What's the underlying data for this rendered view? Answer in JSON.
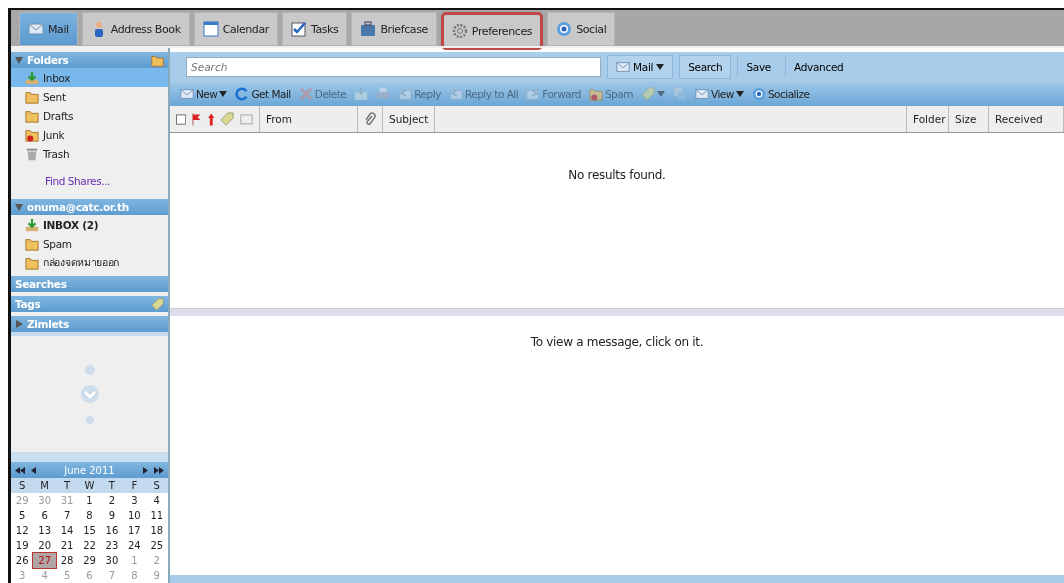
{
  "tabs": [
    {
      "label": "Mail",
      "kind": "envelope",
      "selected": true,
      "highlighted": false
    },
    {
      "label": "Address Book",
      "kind": "person",
      "selected": false,
      "highlighted": false
    },
    {
      "label": "Calendar",
      "kind": "calendar",
      "selected": false,
      "highlighted": false
    },
    {
      "label": "Tasks",
      "kind": "check",
      "selected": false,
      "highlighted": false
    },
    {
      "label": "Briefcase",
      "kind": "briefcase",
      "selected": false,
      "highlighted": false
    },
    {
      "label": "Preferences",
      "kind": "gear",
      "selected": false,
      "highlighted": true
    },
    {
      "label": "Social",
      "kind": "social",
      "selected": false,
      "highlighted": false
    }
  ],
  "sidebar": {
    "folders": {
      "title": "Folders",
      "expanded": true,
      "items": [
        {
          "label": "Inbox",
          "kind": "inbox",
          "selected": true,
          "bold": false
        },
        {
          "label": "Sent",
          "kind": "folder",
          "selected": false,
          "bold": false
        },
        {
          "label": "Drafts",
          "kind": "folder",
          "selected": false,
          "bold": false
        },
        {
          "label": "Junk",
          "kind": "junk",
          "selected": false,
          "bold": false
        },
        {
          "label": "Trash",
          "kind": "trash",
          "selected": false,
          "bold": false
        }
      ],
      "link": "Find Shares..."
    },
    "account": {
      "title": "onuma@catc.or.th",
      "expanded": true,
      "items": [
        {
          "label": "INBOX (2)",
          "kind": "inbox",
          "selected": false,
          "bold": true
        },
        {
          "label": "Spam",
          "kind": "folder",
          "selected": false,
          "bold": false
        },
        {
          "label": "กล่องจดหมายออก",
          "kind": "folder",
          "selected": false,
          "bold": false
        }
      ]
    },
    "searches": {
      "title": "Searches"
    },
    "tags": {
      "title": "Tags"
    },
    "zimlets": {
      "title": "Zimlets",
      "expanded": false
    }
  },
  "calendar": {
    "title": "June 2011",
    "weekdays": [
      "S",
      "M",
      "T",
      "W",
      "T",
      "F",
      "S"
    ],
    "weeks": [
      [
        {
          "label": "29",
          "outside": true,
          "selected": false
        },
        {
          "label": "30",
          "outside": true,
          "selected": false
        },
        {
          "label": "31",
          "outside": true,
          "selected": false
        },
        {
          "label": "1",
          "outside": false,
          "selected": false
        },
        {
          "label": "2",
          "outside": false,
          "selected": false
        },
        {
          "label": "3",
          "outside": false,
          "selected": false
        },
        {
          "label": "4",
          "outside": false,
          "selected": false
        }
      ],
      [
        {
          "label": "5",
          "outside": false,
          "selected": false
        },
        {
          "label": "6",
          "outside": false,
          "selected": false
        },
        {
          "label": "7",
          "outside": false,
          "selected": false
        },
        {
          "label": "8",
          "outside": false,
          "selected": false
        },
        {
          "label": "9",
          "outside": false,
          "selected": false
        },
        {
          "label": "10",
          "outside": false,
          "selected": false
        },
        {
          "label": "11",
          "outside": false,
          "selected": false
        }
      ],
      [
        {
          "label": "12",
          "outside": false,
          "selected": false
        },
        {
          "label": "13",
          "outside": false,
          "selected": false
        },
        {
          "label": "14",
          "outside": false,
          "selected": false
        },
        {
          "label": "15",
          "outside": false,
          "selected": false
        },
        {
          "label": "16",
          "outside": false,
          "selected": false
        },
        {
          "label": "17",
          "outside": false,
          "selected": false
        },
        {
          "label": "18",
          "outside": false,
          "selected": false
        }
      ],
      [
        {
          "label": "19",
          "outside": false,
          "selected": false
        },
        {
          "label": "20",
          "outside": false,
          "selected": false
        },
        {
          "label": "21",
          "outside": false,
          "selected": false
        },
        {
          "label": "22",
          "outside": false,
          "selected": false
        },
        {
          "label": "23",
          "outside": false,
          "selected": false
        },
        {
          "label": "24",
          "outside": false,
          "selected": false
        },
        {
          "label": "25",
          "outside": false,
          "selected": false
        }
      ],
      [
        {
          "label": "26",
          "outside": false,
          "selected": false
        },
        {
          "label": "27",
          "outside": false,
          "selected": true
        },
        {
          "label": "28",
          "outside": false,
          "selected": false
        },
        {
          "label": "29",
          "outside": false,
          "selected": false
        },
        {
          "label": "30",
          "outside": false,
          "selected": false
        },
        {
          "label": "1",
          "outside": true,
          "selected": false
        },
        {
          "label": "2",
          "outside": true,
          "selected": false
        }
      ],
      [
        {
          "label": "3",
          "outside": true,
          "selected": false
        },
        {
          "label": "4",
          "outside": true,
          "selected": false
        },
        {
          "label": "5",
          "outside": true,
          "selected": false
        },
        {
          "label": "6",
          "outside": true,
          "selected": false
        },
        {
          "label": "7",
          "outside": true,
          "selected": false
        },
        {
          "label": "8",
          "outside": true,
          "selected": false
        },
        {
          "label": "9",
          "outside": true,
          "selected": false
        }
      ]
    ]
  },
  "search": {
    "placeholder": "Search",
    "scope": "Mail",
    "button": "Search",
    "save": "Save",
    "advanced": "Advanced"
  },
  "toolbar": [
    {
      "label": "New",
      "kind": "envelope",
      "disabled": false,
      "menu": true
    },
    {
      "label": "Get Mail",
      "kind": "refresh",
      "disabled": false,
      "menu": false
    },
    {
      "label": "Delete",
      "kind": "x",
      "disabled": true,
      "menu": false
    },
    {
      "kind": "archive",
      "disabled": true,
      "menu": false
    },
    {
      "kind": "printer",
      "disabled": true,
      "menu": false
    },
    {
      "label": "Reply",
      "kind": "reply",
      "disabled": true,
      "menu": false
    },
    {
      "label": "Reply to All",
      "kind": "reply",
      "disabled": true,
      "menu": false
    },
    {
      "label": "Forward",
      "kind": "forward",
      "disabled": true,
      "menu": false
    },
    {
      "label": "Spam",
      "kind": "junk",
      "disabled": true,
      "menu": false
    },
    {
      "kind": "tag",
      "disabled": true,
      "menu": true
    },
    {
      "kind": "window",
      "disabled": true,
      "menu": false
    },
    {
      "label": "View",
      "kind": "envelope",
      "disabled": false,
      "menu": true
    },
    {
      "label": "Socialize",
      "kind": "social",
      "disabled": false,
      "menu": false
    }
  ],
  "columns": {
    "select_all_checked": false,
    "left": [
      "From",
      "Subject"
    ],
    "right": [
      "Folder",
      "Size",
      "Received"
    ]
  },
  "list": {
    "empty": "No results found."
  },
  "reading_pane": {
    "hint": "To view a message, click on it."
  }
}
